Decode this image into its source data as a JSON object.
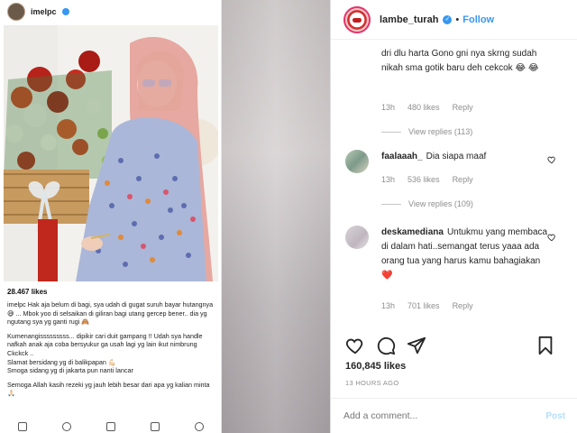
{
  "left_post": {
    "username": "imelpc",
    "likes": "28.467 likes",
    "caption": [
      "imelpc Hak aja belum di bagi, sya udah di gugat suruh bayar hutangnya 😅 ... Mbok yoo di selsaikan di giliran bagi utang gercep bener.. dia yg ngutang sya yg ganti rugi 🙈",
      "Kumenangisssssssss... dipikir cari duit gampang !! Udah sya handle nafkah anak aja coba bersyukur ga usah lagi yg lain ikut nimbrung Ckckck ..\nSlamat bersidang yg di balikpapan 💪🏻\nSmoga sidang yg di jakarta pun nanti lancar",
      "Semoga Allah kasih rezeki yg jauh lebih besar dari apa yg kalian minta 🙏🏻"
    ]
  },
  "right_post": {
    "username": "lambe_turah",
    "follow_label": "Follow",
    "verified_mark": "✓",
    "dot": "•",
    "comments": [
      {
        "user": "",
        "text": "dri dlu harta Gono gni nya skrng sudah nikah sma gotik baru deh cekcok 😂 😂",
        "time": "13h",
        "likes": "480 likes",
        "reply": "Reply",
        "view_replies": "View replies (113)"
      },
      {
        "user": "faalaaah_",
        "text": "Dia siapa maaf",
        "time": "13h",
        "likes": "536 likes",
        "reply": "Reply",
        "view_replies": "View replies (109)"
      },
      {
        "user": "deskamediana",
        "text": "Untukmu yang membaca di dalam hati..semangat terus yaaa ada orang tua yang harus kamu bahagiakan❤️",
        "time": "13h",
        "likes": "701 likes",
        "reply": "Reply",
        "view_replies": ""
      }
    ],
    "likes_count": "160,845 likes",
    "time_ago": "13 HOURS AGO",
    "add_comment_placeholder": "Add a comment...",
    "post_label": "Post"
  },
  "colors": {
    "accent_blue": "#3897f0",
    "secondary_text": "#8e8e8e",
    "post_disabled": "#b2dffc"
  }
}
